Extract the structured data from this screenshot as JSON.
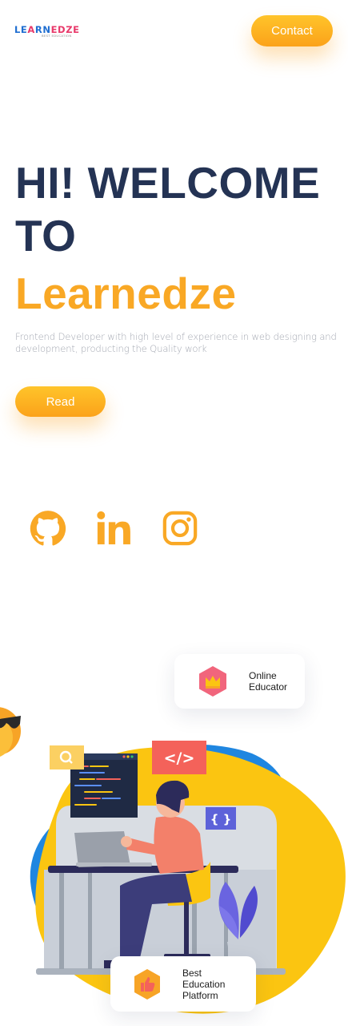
{
  "header": {
    "logo": {
      "part1": "LE",
      "part2": "A",
      "part3": "RN",
      "part4": "EDZE",
      "tagline": "BEST EDUCATION"
    },
    "contact_label": "Contact"
  },
  "hero": {
    "headline_line1": "HI! WELCOME",
    "headline_line2": "TO",
    "brand_name": "Learnedze",
    "description": "Frontend Developer with high level of experience in web designing and development, producting the Quality work",
    "read_label": "Read"
  },
  "social": {
    "items": [
      {
        "icon": "github-icon"
      },
      {
        "icon": "linkedin-icon"
      },
      {
        "icon": "instagram-icon"
      }
    ]
  },
  "cards": {
    "online_line1": "Online",
    "online_line2": "Educator",
    "best_line1": "Best",
    "best_line2": "Education",
    "best_line3": "Platform"
  },
  "illustration": {
    "code_tag": "</>",
    "brace_tag": "{ }"
  },
  "colors": {
    "accent": "#f9a825",
    "heading": "#243354",
    "blob_yellow": "#fbc511",
    "blob_blue": "#1f86e0",
    "tag_red": "#f4625a",
    "tag_purple": "#5d62d9"
  }
}
